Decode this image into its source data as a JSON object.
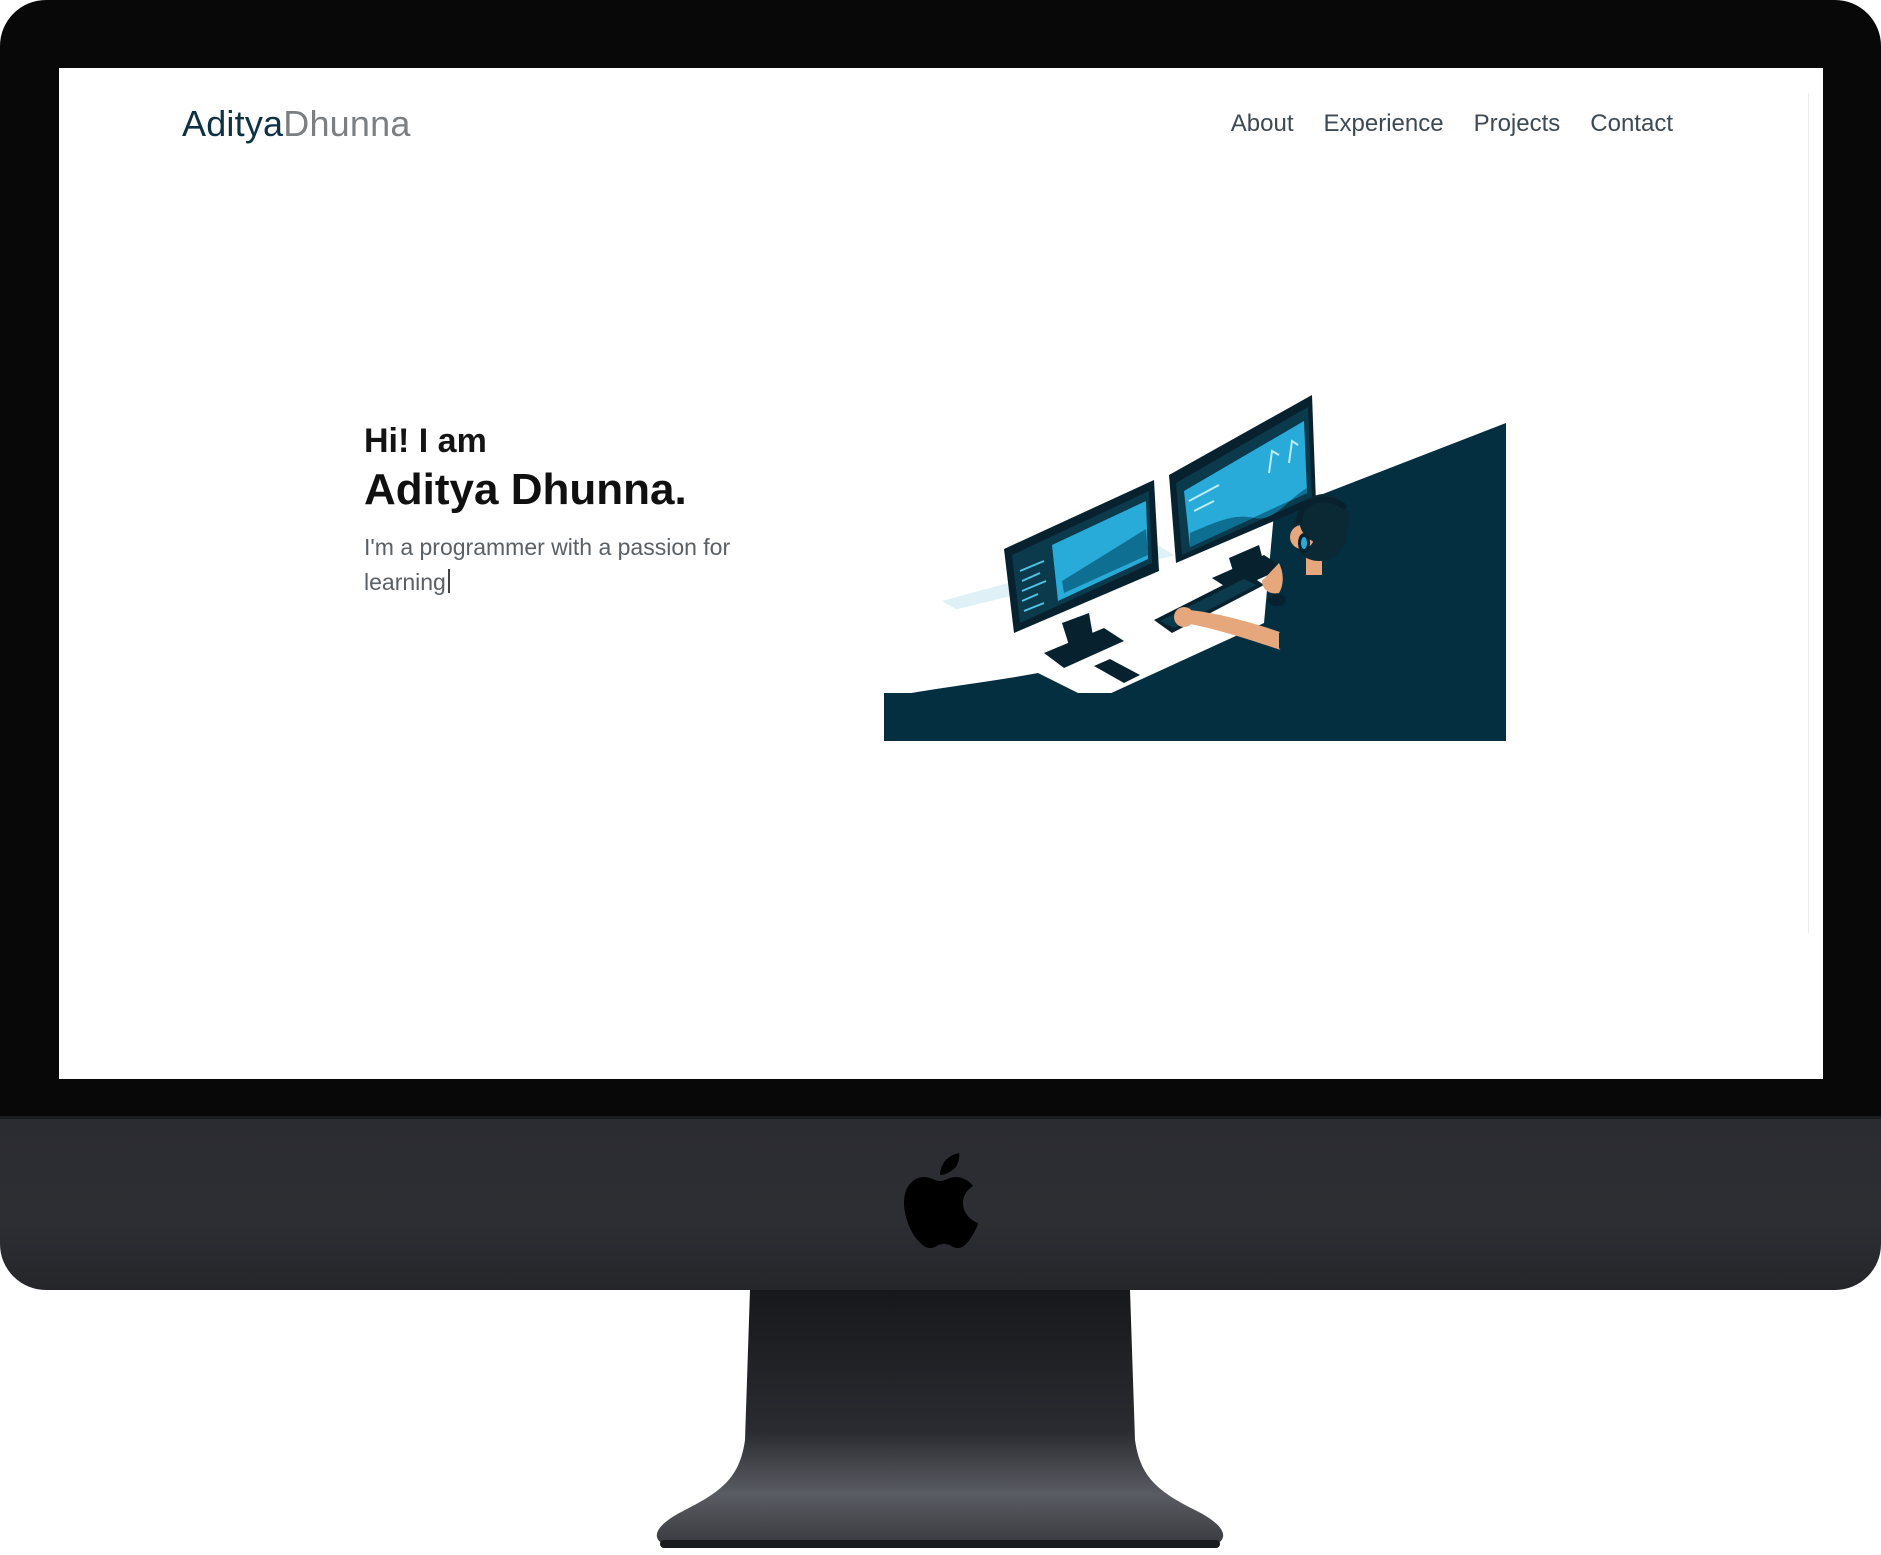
{
  "brand": {
    "first": "Aditya",
    "last": "Dhunna"
  },
  "nav": {
    "items": [
      "About",
      "Experience",
      "Projects",
      "Contact"
    ]
  },
  "hero": {
    "greeting": "Hi! I am",
    "name": "Aditya Dhunna.",
    "tagline": "I'm a programmer with a passion for learning"
  },
  "illustration": {
    "icon": "developer-at-desk-illustration",
    "colors": {
      "primary": "#032f40",
      "accent": "#29abd9",
      "light": "#dff1f6",
      "skin": "#e6a77c"
    }
  },
  "device": {
    "icon": "apple-logo-icon"
  }
}
